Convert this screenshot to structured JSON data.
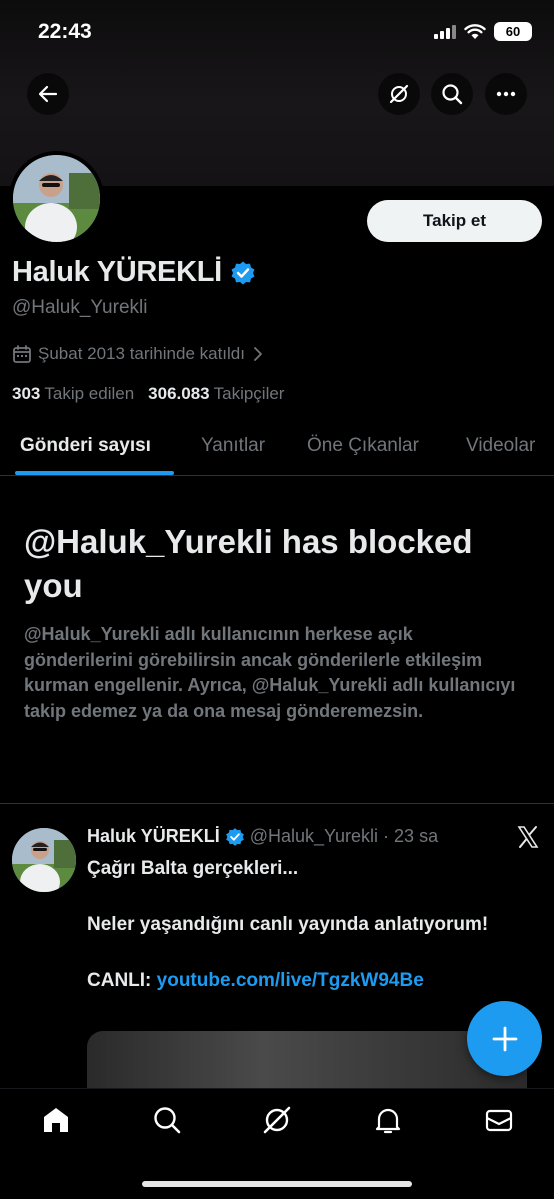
{
  "status_bar": {
    "time": "22:43",
    "battery": "60"
  },
  "profile": {
    "display_name": "Haluk YÜREKLİ",
    "handle": "@Haluk_Yurekli",
    "joined": "Şubat 2013 tarihinde katıldı",
    "following_count": "303",
    "following_label": "Takip edilen",
    "followers_count": "306.083",
    "followers_label": "Takipçiler",
    "follow_button": "Takip et"
  },
  "tabs": [
    {
      "label": "Gönderi sayısı",
      "active": true
    },
    {
      "label": "Yanıtlar"
    },
    {
      "label": "Öne Çıkanlar"
    },
    {
      "label": "Videolar"
    }
  ],
  "blocked": {
    "title": "@Haluk_Yurekli has blocked you",
    "description": "@Haluk_Yurekli adlı kullanıcının herkese açık gönderilerini görebilirsin ancak gönderilerle etkileşim kurman engellenir. Ayrıca, @Haluk_Yurekli adlı kullanıcıyı takip edemez ya da ona mesaj gönderemezsin."
  },
  "post": {
    "author_name": "Haluk YÜREKLİ",
    "author_handle": "@Haluk_Yurekli",
    "separator": "·",
    "time": "23 sa",
    "line1": "Çağrı Balta gerçekleri...",
    "line2": "Neler yaşandığını canlı yayında anlatıyorum!",
    "live_prefix": "CANLI: ",
    "link": "youtube.com/live/TgzkW94Be"
  },
  "icons": {
    "back": "back-arrow-icon",
    "grok": "grok-icon",
    "search": "search-icon",
    "more": "more-icon",
    "verified": "verified-badge-icon",
    "calendar": "calendar-icon",
    "x": "x-logo-icon",
    "compose": "plus-icon",
    "nav": [
      "home-icon",
      "search-icon",
      "grok-icon",
      "bell-icon",
      "mail-icon"
    ]
  },
  "colors": {
    "accent": "#1d9bf0",
    "background": "#000000",
    "text": "#e7e9ea",
    "muted": "#71767b"
  }
}
